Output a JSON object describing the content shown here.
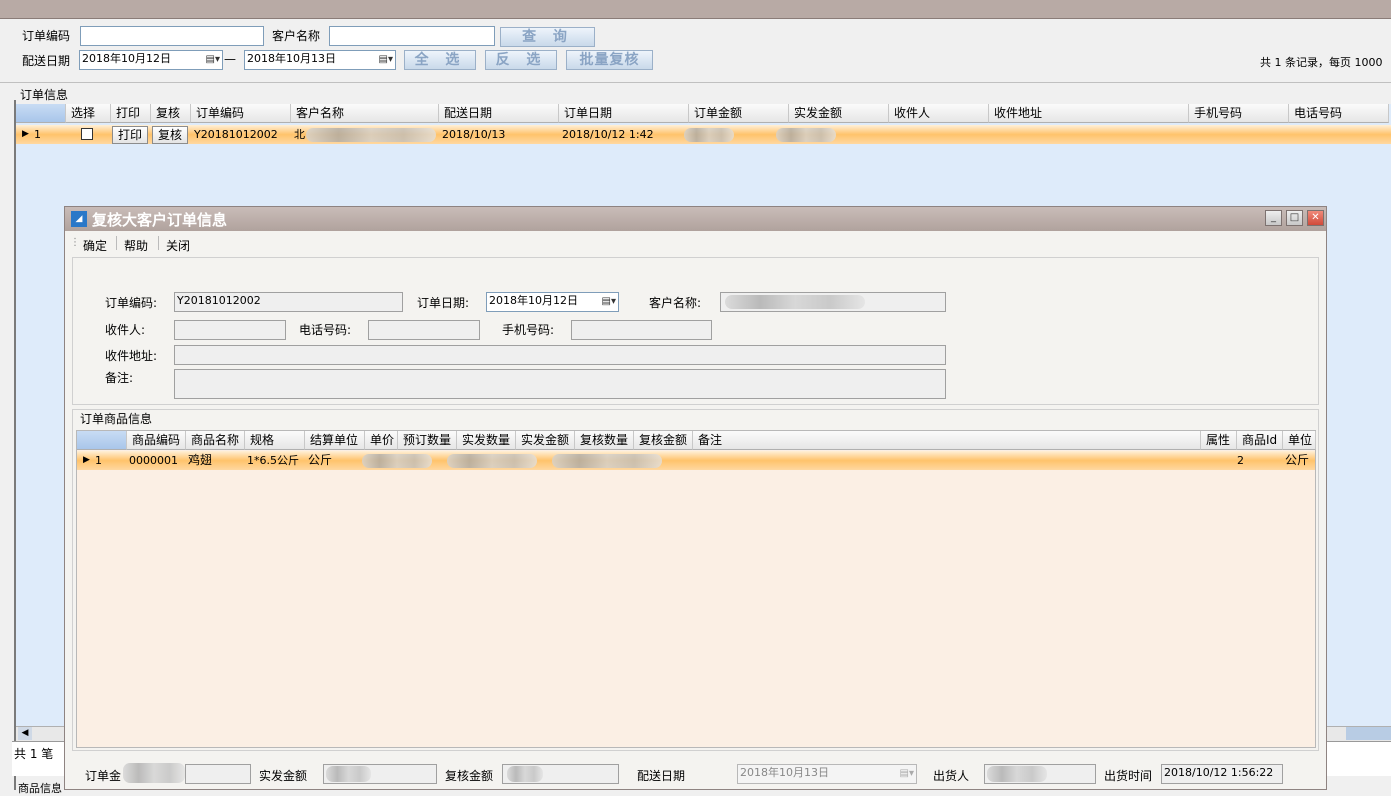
{
  "search": {
    "order_code_label": "订单编码",
    "customer_name_label": "客户名称",
    "query_btn": "查 询",
    "delivery_date_label": "配送日期",
    "date_from": "2018年10月12日",
    "date_sep": "—",
    "date_to": "2018年10月13日",
    "select_all_btn": "全 选",
    "invert_btn": "反 选",
    "batch_review_btn": "批量复核",
    "records_info": "共 1 条记录，每页 1000"
  },
  "order_grid": {
    "section_label": "订单信息",
    "columns": [
      "选择",
      "打印",
      "复核",
      "订单编码",
      "客户名称",
      "配送日期",
      "订单日期",
      "订单金额",
      "实发金额",
      "收件人",
      "收件地址",
      "手机号码",
      "电话号码"
    ],
    "row": {
      "index": "1",
      "print_btn": "打印",
      "review_btn": "复核",
      "order_code": "Y20181012002",
      "customer_prefix": "北",
      "delivery_date": "2018/10/13",
      "order_date": "2018/10/12 1:42"
    },
    "footer_text": "共 1 笔",
    "bottom_label": "商品信息"
  },
  "dialog": {
    "title": "复核大客户订单信息",
    "menu": [
      "确定",
      "帮助",
      "关闭"
    ],
    "form": {
      "order_code_label": "订单编码:",
      "order_code_value": "Y20181012002",
      "order_date_label": "订单日期:",
      "order_date_value": "2018年10月12日",
      "customer_label": "客户名称:",
      "recipient_label": "收件人:",
      "phone_label": "电话号码:",
      "mobile_label": "手机号码:",
      "address_label": "收件地址:",
      "remark_label": "备注:"
    },
    "items": {
      "section_label": "订单商品信息",
      "columns": [
        "商品编码",
        "商品名称",
        "规格",
        "结算单位",
        "单价",
        "预订数量",
        "实发数量",
        "实发金额",
        "复核数量",
        "复核金额",
        "备注",
        "属性",
        "商品Id",
        "单位"
      ],
      "row": {
        "index": "1",
        "code": "0000001",
        "name": "鸡翅",
        "spec": "1*6.5公斤",
        "settle_unit": "公斤",
        "product_id": "2",
        "unit": "公斤"
      }
    },
    "footer": {
      "order_amount_label": "订单金",
      "actual_amount_label": "实发金额",
      "review_amount_label": "复核金额",
      "delivery_date_label": "配送日期",
      "delivery_date_value": "2018年10月13日",
      "shipper_label": "出货人",
      "ship_time_label": "出货时间",
      "ship_time_value": "2018/10/12 1:56:22"
    }
  }
}
